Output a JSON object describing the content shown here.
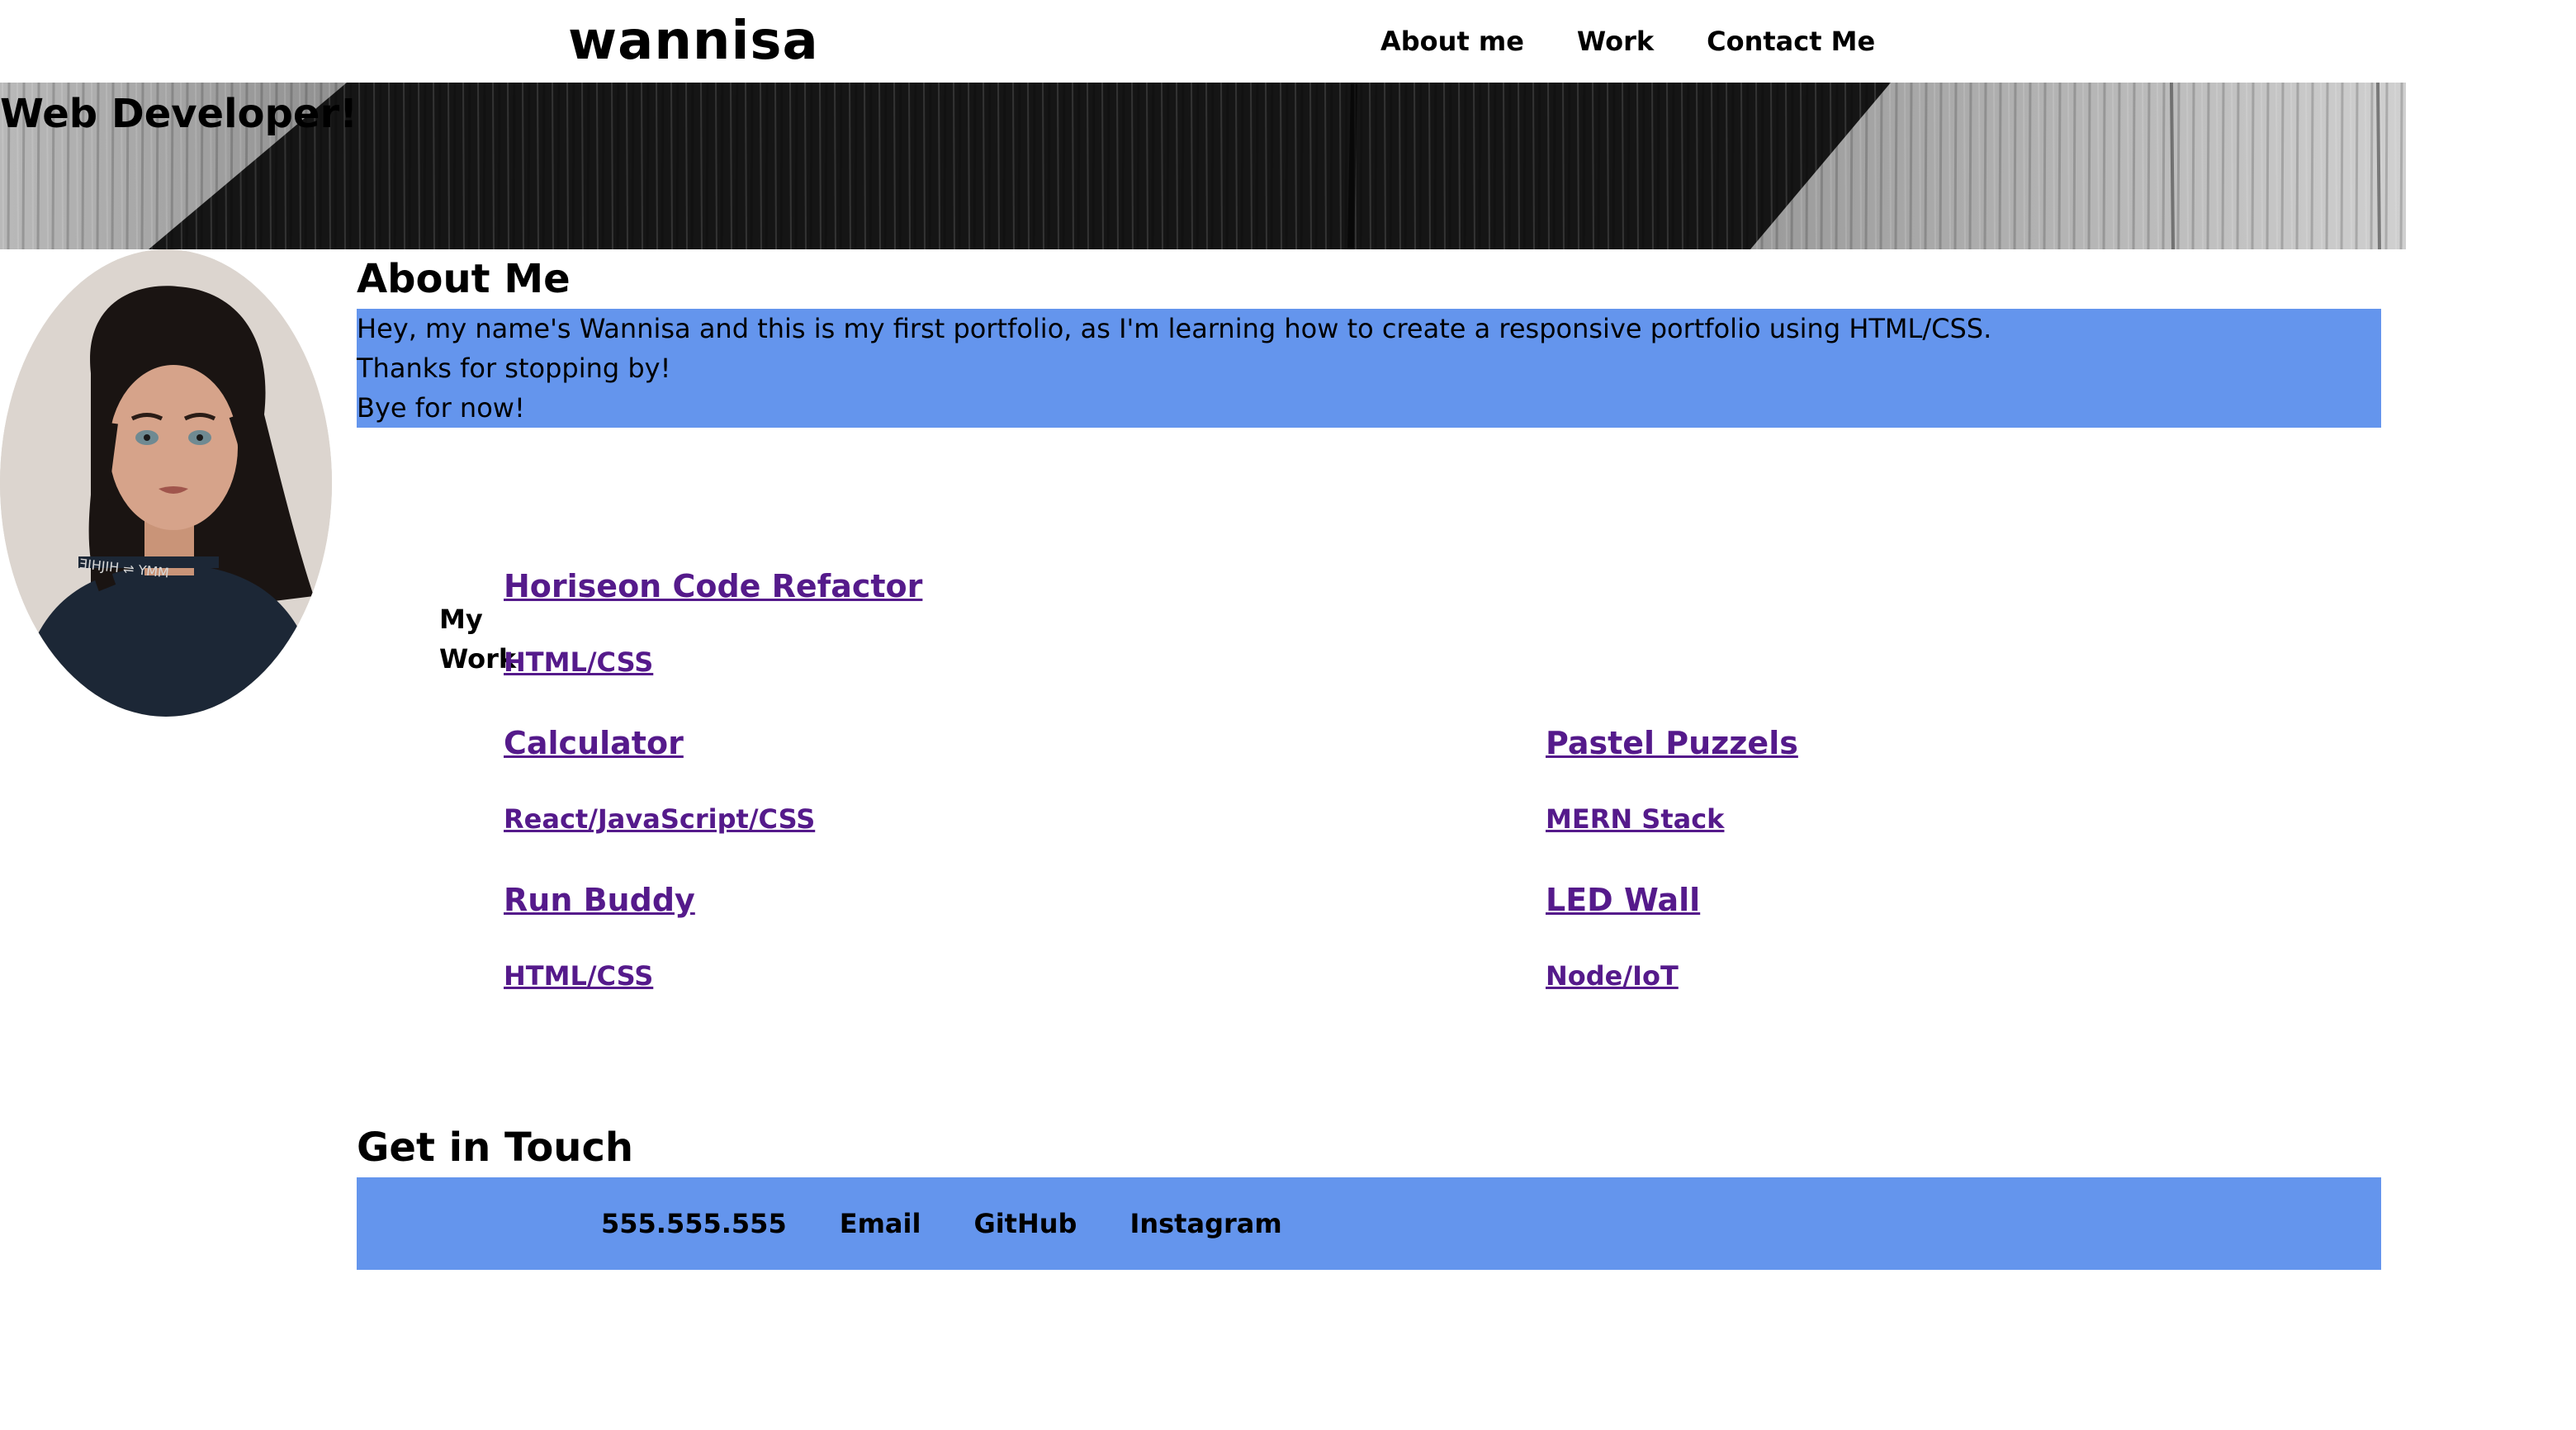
{
  "header": {
    "brand": "wannisa",
    "nav": [
      "About me",
      "Work",
      "Contact Me"
    ]
  },
  "hero": {
    "title": "Web Developer!"
  },
  "about": {
    "heading": "About Me",
    "lines": [
      "Hey, my name's Wannisa and this is my first portfolio, as I'm learning how to create a responsive portfolio using HTML/CSS.",
      "Thanks for stopping by!",
      "Bye for now!"
    ]
  },
  "work": {
    "label": "My Work",
    "projects": [
      {
        "title": "Horiseon Code Refactor",
        "tech": "HTML/CSS"
      },
      {
        "title": "Calculator",
        "tech": "React/JavaScript/CSS"
      },
      {
        "title": "Pastel Puzzels",
        "tech": "MERN Stack"
      },
      {
        "title": "Run Buddy",
        "tech": "HTML/CSS"
      },
      {
        "title": "LED Wall",
        "tech": "Node/IoT"
      }
    ]
  },
  "contact": {
    "heading": "Get in Touch",
    "links": [
      "555.555.555",
      "Email",
      "GitHub",
      "Instagram"
    ]
  },
  "colors": {
    "accent": "#6495ed",
    "link": "#551a8b"
  }
}
